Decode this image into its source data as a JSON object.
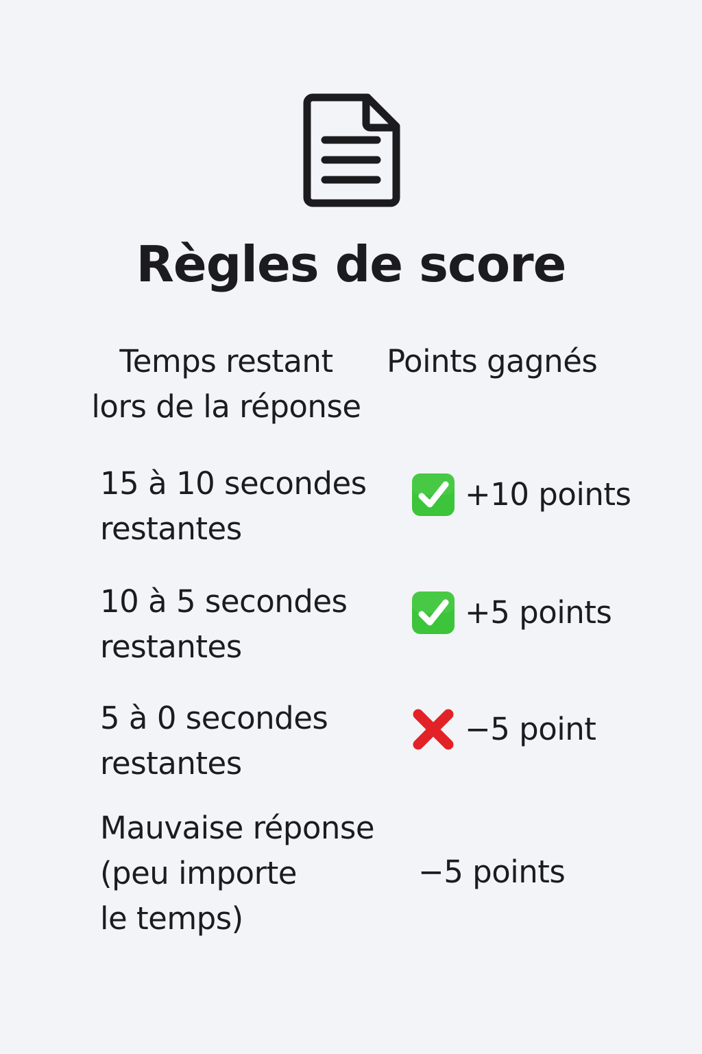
{
  "page": {
    "title": "Règles de score",
    "icon": "document-icon"
  },
  "headers": {
    "time": "Temps restant\nlors de la réponse",
    "points": "Points gagnés"
  },
  "rules": [
    {
      "label": "15 à 10 secondes\nrestantes",
      "icon": "check-mark-icon",
      "points": "+10 points"
    },
    {
      "label": "10 à 5 secondes\nrestantes",
      "icon": "check-mark-icon",
      "points": "+5 points"
    },
    {
      "label": "5 à 0 secondes\nrestantes",
      "icon": "cross-mark-icon",
      "points": "−5 point"
    },
    {
      "label": "Mauvaise réponse\n(peu importe\nle temps)",
      "icon": "",
      "points": "−5 points"
    }
  ],
  "colors": {
    "background": "#f3f4f7",
    "text": "#1c1c1e",
    "check": "#3cc43a",
    "cross": "#e32227"
  }
}
